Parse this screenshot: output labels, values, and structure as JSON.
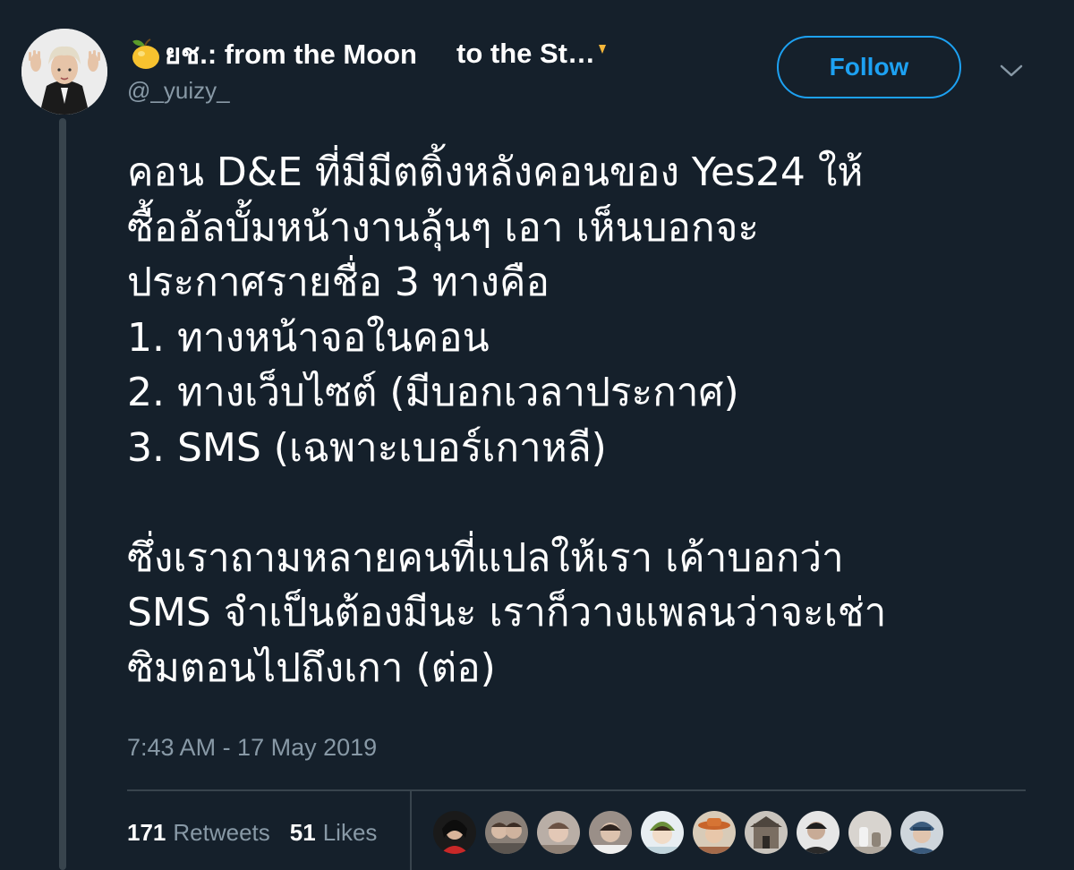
{
  "user": {
    "display_name_prefix": "ยช.: from the Moon",
    "display_name_middle": "to the St…",
    "handle": "@_yuizy_",
    "avatar_icon": "user-avatar"
  },
  "actions": {
    "follow_label": "Follow",
    "more_icon": "chevron-down-icon"
  },
  "tweet": {
    "lines": [
      "คอน D&E ที่มีมีตติ้งหลังคอนของ Yes24 ให้",
      "ซื้ออัลบั้มหน้างานลุ้นๆ เอา เห็นบอกจะ",
      "ประกาศรายชื่อ 3 ทางคือ",
      "1. ทางหน้าจอในคอน",
      "2. ทางเว็บไซต์ (มีบอกเวลาประกาศ)",
      "3. SMS (เฉพาะเบอร์เกาหลี)",
      "",
      "ซึ่งเราถามหลายคนที่แปลให้เรา เค้าบอกว่า",
      "SMS จำเป็นต้องมีนะ เราก็วางแพลนว่าจะเช่า",
      "ซิมตอนไปถึงเกา (ต่อ)"
    ],
    "timestamp": "7:43 AM - 17 May 2019"
  },
  "stats": {
    "retweets_count": "171",
    "retweets_label": "Retweets",
    "likes_count": "51",
    "likes_label": "Likes"
  },
  "likers_count": 9,
  "colors": {
    "background": "#15202b",
    "accent": "#1da1f2",
    "secondary_text": "#8899a6",
    "divider": "#38444d"
  }
}
